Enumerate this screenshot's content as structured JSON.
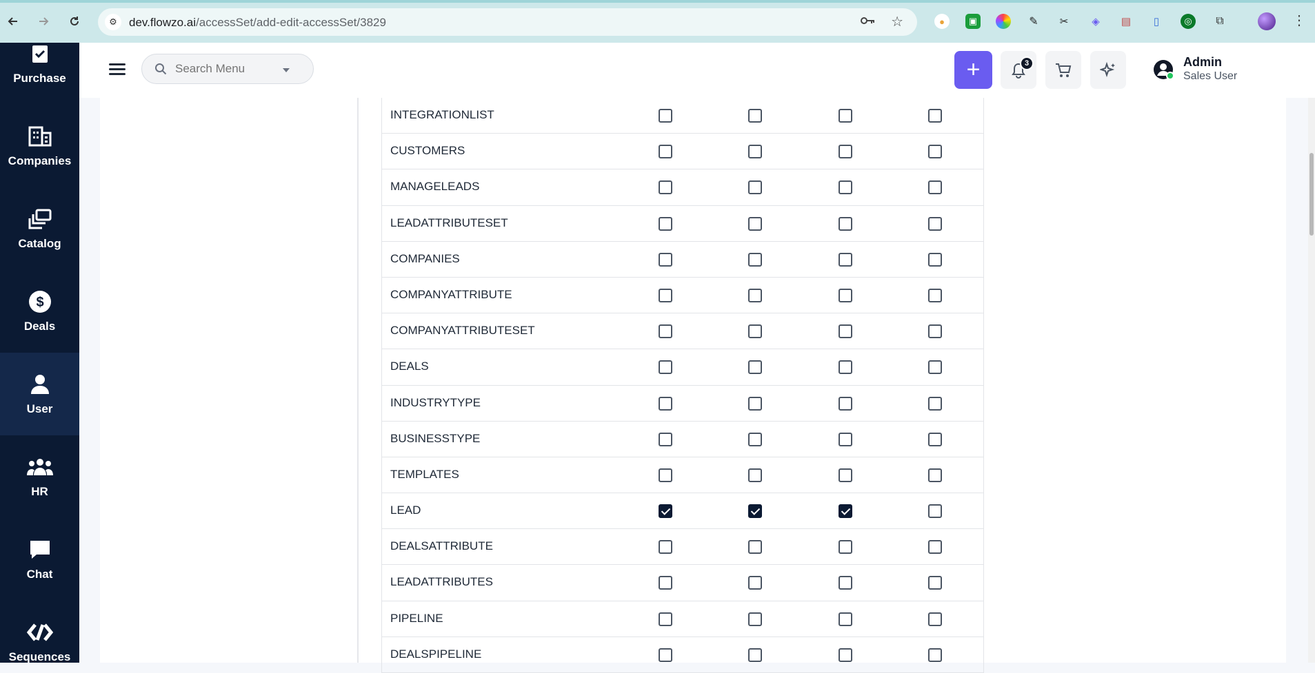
{
  "browser": {
    "url_host": "dev.flowzo.ai",
    "url_path": "/accessSet/add-edit-accessSet/3829"
  },
  "sidebar": {
    "items": [
      {
        "label": "Purchase",
        "icon": "clipboard-check-icon"
      },
      {
        "label": "Companies",
        "icon": "building-icon"
      },
      {
        "label": "Catalog",
        "icon": "catalog-stack-icon"
      },
      {
        "label": "Deals",
        "icon": "dollar-circle-icon"
      },
      {
        "label": "User",
        "icon": "user-icon"
      },
      {
        "label": "HR",
        "icon": "people-group-icon"
      },
      {
        "label": "Chat",
        "icon": "chat-bubble-icon"
      },
      {
        "label": "Sequences",
        "icon": "sequences-icon"
      }
    ]
  },
  "header": {
    "search_placeholder": "Search Menu",
    "notification_count": "3",
    "user_name": "Admin",
    "user_role": "Sales User"
  },
  "table": {
    "rows": [
      {
        "name": "INTEGRATIONLIST",
        "checks": [
          false,
          false,
          false,
          false
        ]
      },
      {
        "name": "CUSTOMERS",
        "checks": [
          false,
          false,
          false,
          false
        ]
      },
      {
        "name": "MANAGELEADS",
        "checks": [
          false,
          false,
          false,
          false
        ]
      },
      {
        "name": "LEADATTRIBUTESET",
        "checks": [
          false,
          false,
          false,
          false
        ]
      },
      {
        "name": "COMPANIES",
        "checks": [
          false,
          false,
          false,
          false
        ]
      },
      {
        "name": "COMPANYATTRIBUTE",
        "checks": [
          false,
          false,
          false,
          false
        ]
      },
      {
        "name": "COMPANYATTRIBUTESET",
        "checks": [
          false,
          false,
          false,
          false
        ]
      },
      {
        "name": "DEALS",
        "checks": [
          false,
          false,
          false,
          false
        ]
      },
      {
        "name": "INDUSTRYTYPE",
        "checks": [
          false,
          false,
          false,
          false
        ]
      },
      {
        "name": "BUSINESSTYPE",
        "checks": [
          false,
          false,
          false,
          false
        ]
      },
      {
        "name": "TEMPLATES",
        "checks": [
          false,
          false,
          false,
          false
        ]
      },
      {
        "name": "LEAD",
        "checks": [
          true,
          true,
          true,
          false
        ]
      },
      {
        "name": "DEALSATTRIBUTE",
        "checks": [
          false,
          false,
          false,
          false
        ]
      },
      {
        "name": "LEADATTRIBUTES",
        "checks": [
          false,
          false,
          false,
          false
        ]
      },
      {
        "name": "PIPELINE",
        "checks": [
          false,
          false,
          false,
          false
        ]
      },
      {
        "name": "DEALSPIPELINE",
        "checks": [
          false,
          false,
          false,
          false
        ]
      }
    ]
  },
  "colors": {
    "sidebar_bg": "#0b1a33",
    "accent": "#6a5cf0",
    "checked": "#0b1a33"
  }
}
